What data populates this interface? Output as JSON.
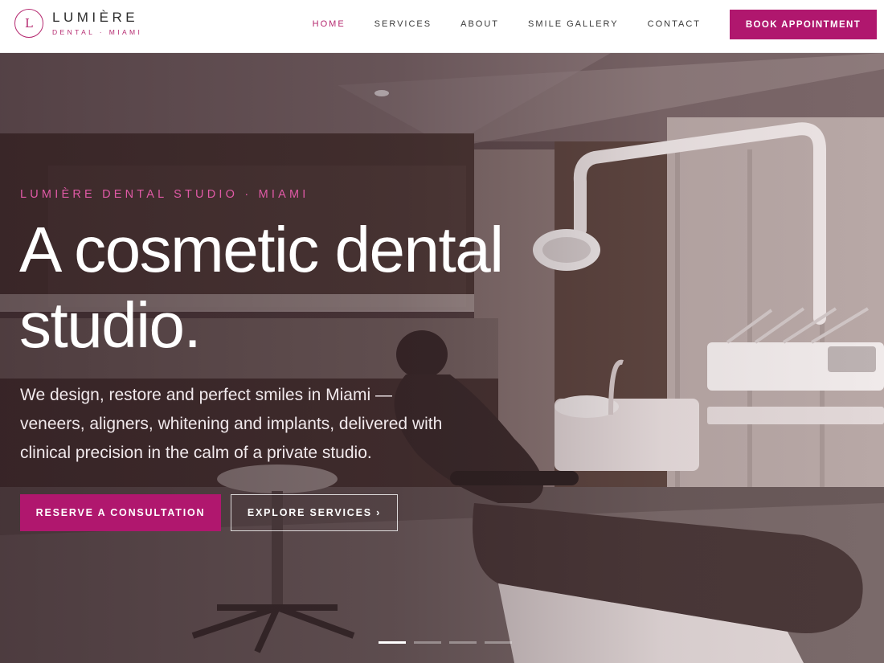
{
  "brand": {
    "monogram": "L",
    "name": "LUMIÈRE",
    "tagline": "DENTAL · MIAMI"
  },
  "nav": {
    "items": [
      {
        "label": "HOME",
        "active": true
      },
      {
        "label": "SERVICES",
        "active": false
      },
      {
        "label": "ABOUT",
        "active": false
      },
      {
        "label": "SMILE GALLERY",
        "active": false
      },
      {
        "label": "CONTACT",
        "active": false
      }
    ],
    "cta_label": "BOOK APPOINTMENT"
  },
  "hero": {
    "eyebrow": "LUMIÈRE DENTAL STUDIO · MIAMI",
    "headline": "A cosmetic dental studio.",
    "lede": "We design, restore and perfect smiles in Miami — veneers, aligners, whitening and implants, delivered with clinical precision in the calm of a private studio.",
    "primary_cta": "RESERVE A CONSULTATION",
    "secondary_cta": "EXPLORE SERVICES ›",
    "background_image": "dental-treatment-room-photo",
    "slides_total": 4,
    "active_slide": 1
  },
  "colors": {
    "accent": "#b0176e",
    "accent_light": "#e05aa6",
    "text_dark": "#2c2c2c"
  }
}
